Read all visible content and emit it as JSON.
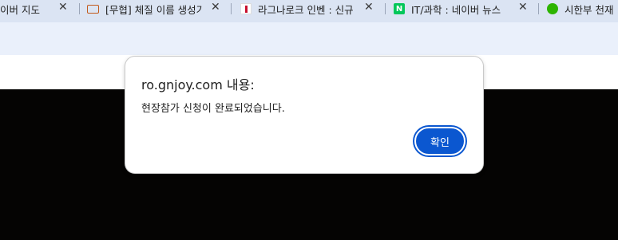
{
  "tabs": [
    {
      "title": "이버 지도",
      "favicon": "none"
    },
    {
      "title": "[무협] 체질 이름 생성기",
      "favicon": "folder-icon"
    },
    {
      "title": "라그나로크 인벤 : 신규",
      "favicon": "ragnarok-icon"
    },
    {
      "title": "IT/과학 : 네이버 뉴스",
      "favicon": "naver-icon",
      "favicon_text": "N"
    },
    {
      "title": "시한부 천재",
      "favicon": "webtoon-icon"
    }
  ],
  "tab_close_glyph": "✕",
  "dialog": {
    "title": "ro.gnjoy.com 내용:",
    "message": "현장참가 신청이 완료되었습니다.",
    "ok_label": "확인"
  },
  "colors": {
    "tabstrip_bg": "#dbe4f3",
    "toolbar_bg": "#eaf0fb",
    "page_dark_bg": "#050403",
    "button_blue": "#0b57d0",
    "naver_green": "#03c75a"
  }
}
